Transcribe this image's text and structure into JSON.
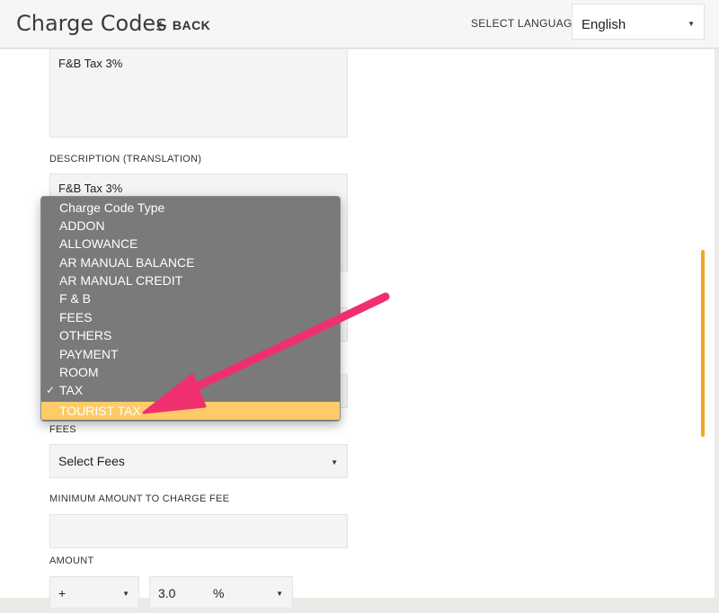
{
  "header": {
    "title": "Charge Codes",
    "back_label": "BACK",
    "language_label": "SELECT LANGUAGE",
    "language_value": "English"
  },
  "form": {
    "description_value": "F&B Tax 3%",
    "description_translation_label": "DESCRIPTION (TRANSLATION)",
    "description_translation_value": "F&B Tax 3%",
    "fees_label": "FEES",
    "fees_value": "Select Fees",
    "min_amount_label": "MINIMUM AMOUNT TO CHARGE FEE",
    "min_amount_value": "",
    "amount_label": "AMOUNT",
    "amount_sign": "+",
    "amount_value": "3.0",
    "amount_unit": "%"
  },
  "dropdown": {
    "items": [
      "Charge Code Type",
      "ADDON",
      "ALLOWANCE",
      "AR MANUAL BALANCE",
      "AR MANUAL CREDIT",
      "F & B",
      "FEES",
      "OTHERS",
      "PAYMENT",
      "ROOM",
      "TAX",
      "TOURIST TAX"
    ],
    "selected_index": 10,
    "highlight_index": 11,
    "check_mark": "✓"
  },
  "colors": {
    "highlight": "#fecb68",
    "annotation_arrow": "#f0306e",
    "scrollbar": "#f5a623"
  }
}
